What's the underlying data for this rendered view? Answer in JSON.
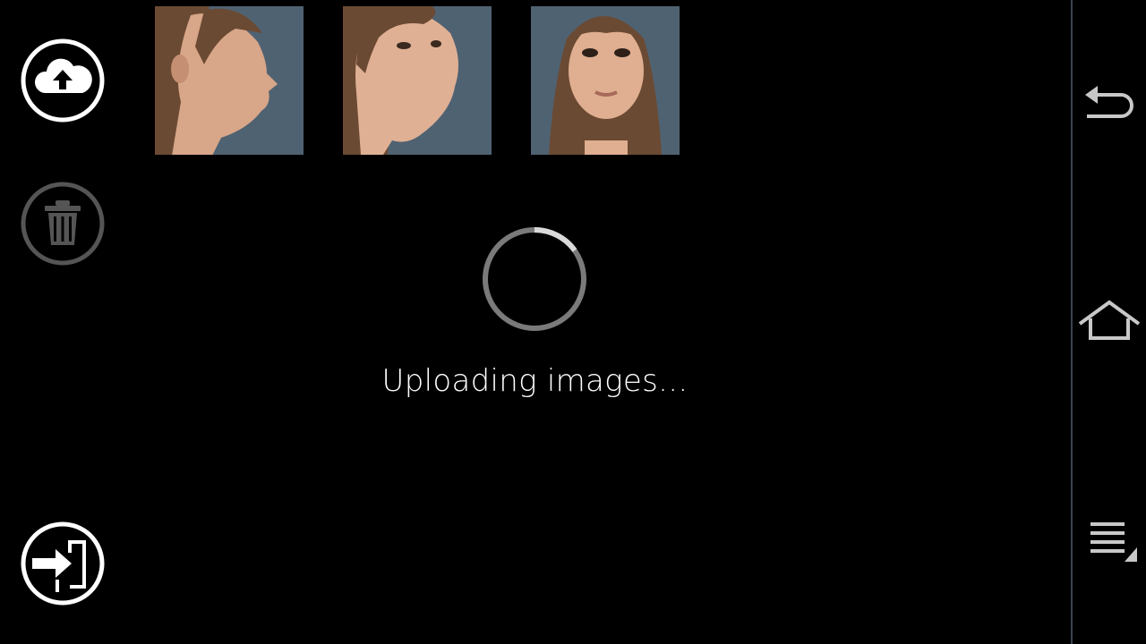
{
  "sidebar": {
    "upload_icon": "cloud-upload-icon",
    "delete_icon": "trash-icon",
    "exit_icon": "sign-in-icon"
  },
  "photos": [
    {
      "view": "profile-right"
    },
    {
      "view": "three-quarter-right"
    },
    {
      "view": "frontal"
    }
  ],
  "status": {
    "text": "Uploading images..."
  },
  "navbar": {
    "icons": [
      "back-icon",
      "home-icon",
      "menu-icon"
    ]
  },
  "colors": {
    "background": "#000000",
    "icon_active": "#ffffff",
    "icon_disabled": "#555555",
    "photo_backdrop": "#4f6272",
    "navbar_divider": "#3a4450"
  }
}
